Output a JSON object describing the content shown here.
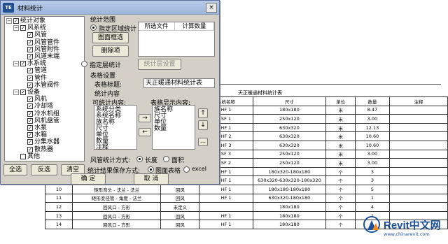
{
  "dialog": {
    "title": "材料统计",
    "icon_text": "TE",
    "close_symbol": "×",
    "tree": [
      {
        "label": "统计对象",
        "level": 0,
        "expanded": true
      },
      {
        "label": "风系统",
        "level": 1,
        "expanded": true
      },
      {
        "label": "风管",
        "level": 2
      },
      {
        "label": "风管管件",
        "level": 2
      },
      {
        "label": "风管附件",
        "level": 2
      },
      {
        "label": "风道末端",
        "level": 2
      },
      {
        "label": "水系统",
        "level": 1,
        "expanded": true
      },
      {
        "label": "管道",
        "level": 2
      },
      {
        "label": "管件",
        "level": 2
      },
      {
        "label": "水管阀件",
        "level": 2
      },
      {
        "label": "设备",
        "level": 1,
        "expanded": true
      },
      {
        "label": "风机",
        "level": 2
      },
      {
        "label": "冷却塔",
        "level": 2
      },
      {
        "label": "冷水机组",
        "level": 2
      },
      {
        "label": "风机盘管",
        "level": 2
      },
      {
        "label": "水泵",
        "level": 2
      },
      {
        "label": "水箱",
        "level": 2
      },
      {
        "label": "分集水器",
        "level": 2
      },
      {
        "label": "散热器",
        "level": 2
      },
      {
        "label": "其他",
        "level": 1
      }
    ],
    "scope_title": "统计范围",
    "scope_option1": "指定区域统计",
    "btn_pick": "图面框选",
    "btn_delete": "删除项",
    "files_col1": "所选文件",
    "files_col2": "计算数量",
    "scope_option2": "指定层统计",
    "btn_layer_setting": "统计层设置",
    "table_settings_title": "表格设置",
    "table_title_label": "表格标题:",
    "table_title_value": "天正暖通材料统计表",
    "content_title": "统计内容",
    "available_label": "可统计内容:",
    "available_items": [
      "系统分类",
      "系统名称",
      "族名称",
      "尺寸",
      "单位",
      "数量",
      "注释"
    ],
    "shown_label": "表格显示内容:",
    "shown_items": [
      "族名称",
      "尺寸",
      "单位",
      "数量"
    ],
    "arrow_right": "→",
    "arrow_left": "←",
    "arrow_up": "↑",
    "arrow_down": "↓",
    "ellipsis": "...",
    "duct_method_label": "风管统计方式:",
    "duct_opt1": "长度",
    "duct_opt2": "面积",
    "save_label": "统计结果保存方式:",
    "save_opt1": "图面表格",
    "save_opt2": "excel",
    "btn_select_all": "全选",
    "btn_invert": "反选",
    "btn_clear": "清空",
    "btn_ok": "确 定",
    "btn_cancel": "取 消"
  },
  "background_table": {
    "title": "天正暖通材料统计表",
    "header": [
      "",
      "",
      "",
      "系统名称",
      "尺寸",
      "单位",
      "数量",
      "注释"
    ],
    "rows": [
      [
        "",
        "",
        "",
        "HF 1",
        "180x180",
        "米",
        "8.47",
        ""
      ],
      [
        "",
        "",
        "",
        "SF 1",
        "250x120",
        "米",
        "3.00",
        ""
      ],
      [
        "",
        "",
        "",
        "HF 1",
        "630x320",
        "米",
        "12.13",
        ""
      ],
      [
        "",
        "",
        "",
        "HF 2",
        "630x320",
        "米",
        "10.60",
        ""
      ],
      [
        "",
        "",
        "",
        "HF 3",
        "630x320",
        "米",
        "10.60",
        ""
      ],
      [
        "",
        "",
        "",
        "SF 3",
        "250x120",
        "米",
        "3.00",
        ""
      ],
      [
        "",
        "",
        "",
        "SF 2",
        "250x120",
        "米",
        "3.00",
        ""
      ],
      [
        "",
        "",
        "",
        "HF 1",
        "180x320-180x180",
        "个",
        "3",
        ""
      ],
      [
        "",
        "",
        "",
        "HF 1",
        "630x320-630x320-180x320",
        "个",
        "3",
        ""
      ],
      [
        "10",
        "矩形弯头 - 法兰 - 法兰",
        "回风",
        "HF 1",
        "180x180-180x180",
        "个",
        "5",
        ""
      ],
      [
        "11",
        "矩形变径管 - 角度 - 法兰",
        "回风",
        "HF 1",
        "630x320-180x180",
        "个",
        "1",
        ""
      ],
      [
        "12",
        "回风口 - 方形",
        "未定义",
        "",
        "180x180",
        "个",
        "4",
        ""
      ],
      [
        "13",
        "回风口 - 方形",
        "回风",
        "HF 1",
        "180x180",
        "个",
        "1",
        ""
      ],
      [
        "14",
        "回风口 - 方形",
        "回风",
        "HF 1",
        "180x180",
        "个",
        "1",
        ""
      ]
    ]
  },
  "watermark": {
    "brand": "Revit中文网",
    "url": "www.chinarevit.com",
    "colors": {
      "blue": "#1b4f9c",
      "orange": "#f08a1c"
    }
  }
}
